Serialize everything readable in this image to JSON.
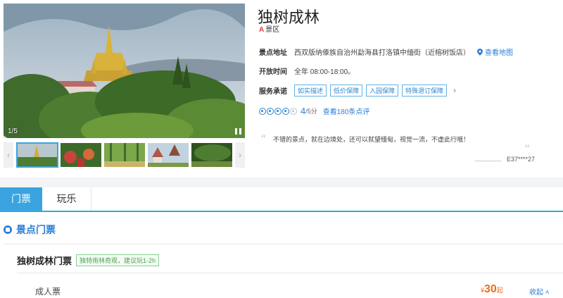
{
  "attraction": {
    "title": "独树成林",
    "grade_mark": "A",
    "grade_label": "景区",
    "image_counter": "1/5"
  },
  "info": {
    "address_label": "景点地址",
    "address_value": "西双版纳傣族自治州勐海县打洛镇中缅街（近榕树饭店）",
    "map_link": "查看地图",
    "hours_label": "开放时间",
    "hours_value": "全年 08:00-18:00。",
    "service_label": "服务承诺",
    "service_tags": [
      "如实描述",
      "低价保障",
      "入园保障",
      "特殊退订保障"
    ]
  },
  "rating": {
    "filled": 4,
    "total": 5,
    "score": "4",
    "score_suffix": "/5分",
    "reviews_link": "查看180条点评"
  },
  "review": {
    "text": "不错的景点，就在边境处，还可以就望缅甸，视觉一流，不虚此行哦！",
    "user": "E37****27"
  },
  "tabs": [
    {
      "label": "门票",
      "active": true
    },
    {
      "label": "玩乐",
      "active": false
    }
  ],
  "tickets": {
    "section_title": "景点门票",
    "product_name": "独树成林门票",
    "product_tag": "独特雨林奇观，建议玩1-2h",
    "adult_label": "成人票",
    "price_currency": "¥",
    "price_value": "30",
    "price_suffix": "起",
    "collapse_label": "收起"
  },
  "colors": {
    "accent": "#3aa4e0",
    "link": "#2a7fd4",
    "price": "#f06a1e",
    "grade": "#e03a3a"
  }
}
